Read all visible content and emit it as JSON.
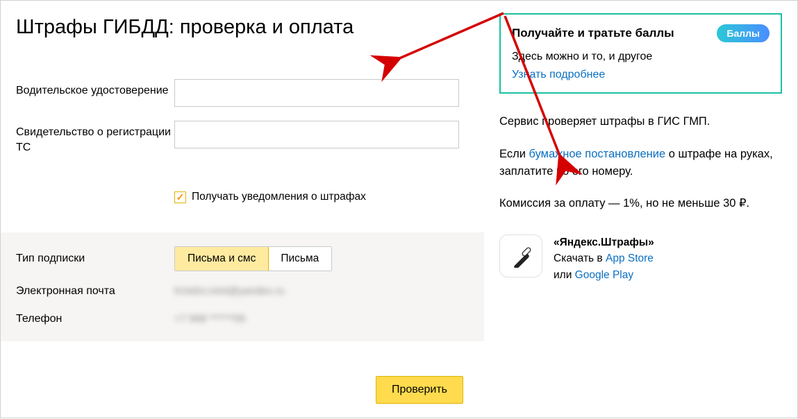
{
  "page": {
    "title": "Штрафы ГИБДД: проверка и оплата"
  },
  "form": {
    "license_label": "Водительское удостоверение",
    "registration_label": "Свидетельство о регистрации ТС",
    "notify_label": "Получать уведомления о штрафах",
    "notify_checked": true,
    "subscription_type_label": "Тип подписки",
    "seg_option_a": "Письма и смс",
    "seg_option_b": "Письма",
    "email_label": "Электронная почта",
    "email_value": "Kristini.mint@yandex.ru",
    "phone_label": "Телефон",
    "phone_value": "+7 968 ******09",
    "submit_label": "Проверить"
  },
  "promo": {
    "title": "Получайте и тратьте баллы",
    "badge": "Баллы",
    "subtitle": "Здесь можно и то, и другое",
    "learn_more": "Узнать подробнее"
  },
  "info": {
    "line1": "Сервис проверяет штрафы в ГИС ГМП.",
    "line2_pre": "Если ",
    "line2_link": "бумажное постановление",
    "line2_post": " о штрафе на руках, заплатите по его номеру.",
    "line3": "Комиссия за оплату — 1%, но не меньше 30 ₽."
  },
  "app": {
    "name": "«Яндекс.Штрафы»",
    "download_pre": "Скачать в ",
    "app_store": "App Store",
    "or": "или ",
    "google_play": "Google Play"
  }
}
